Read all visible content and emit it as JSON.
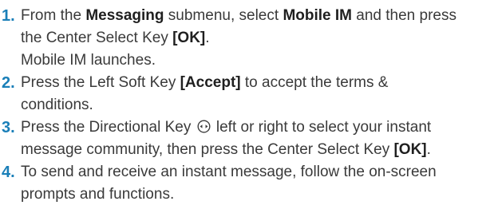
{
  "accent_color": "#1a7fb8",
  "steps": [
    {
      "number": "1.",
      "line1_a": "From the ",
      "line1_b": "Messaging",
      "line1_c": " submenu, select ",
      "line1_d": "Mobile IM",
      "line1_e": " and then press",
      "line2_a": "the Center Select Key ",
      "line2_b": "[OK]",
      "line2_c": ".",
      "line3": "Mobile IM launches."
    },
    {
      "number": "2.",
      "line1_a": "Press the Left Soft Key ",
      "line1_b": "[Accept]",
      "line1_c": " to accept the terms &",
      "line2": "conditions."
    },
    {
      "number": "3.",
      "line1_a": "Press the Directional Key ",
      "line1_b": " left or right to select your instant",
      "line2_a": "message community, then press the Center Select Key ",
      "line2_b": "[OK]",
      "line2_c": ".",
      "icon": "directional-key-icon"
    },
    {
      "number": "4.",
      "line1": "To send and receive an instant message, follow the on-screen",
      "line2": "prompts and functions."
    }
  ]
}
